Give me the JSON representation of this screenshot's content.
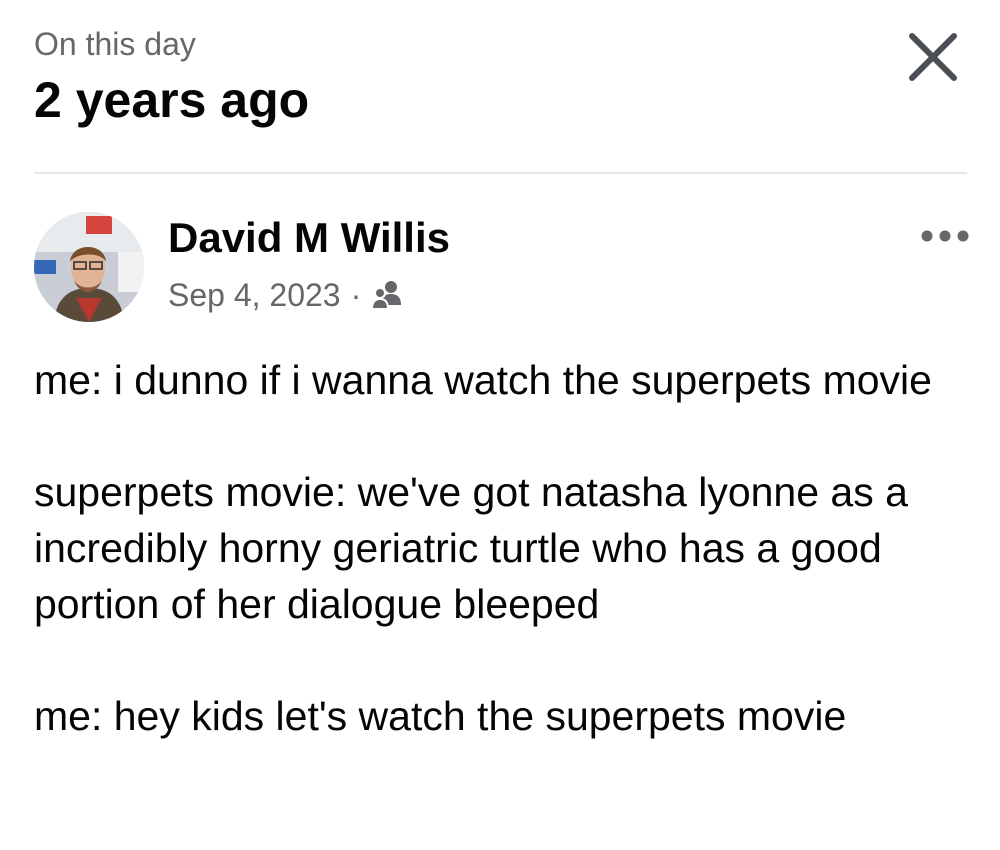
{
  "header": {
    "subtitle": "On this day",
    "title": "2 years ago"
  },
  "post": {
    "author": "David M Willis",
    "date": "Sep 4, 2023",
    "separator": "·",
    "audience_icon": "friends-icon",
    "paragraphs": [
      "me: i dunno if i wanna watch the superpets movie",
      "superpets movie: we've got natasha lyonne as a incredibly horny geriatric turtle who has a good portion of her dialogue bleeped",
      "me: hey kids let's watch the superpets movie"
    ]
  },
  "icons": {
    "close": "close-icon",
    "more": "more-options-icon"
  },
  "colors": {
    "text": "#050505",
    "secondary_text": "#65676b",
    "divider": "#e4e6eb"
  }
}
